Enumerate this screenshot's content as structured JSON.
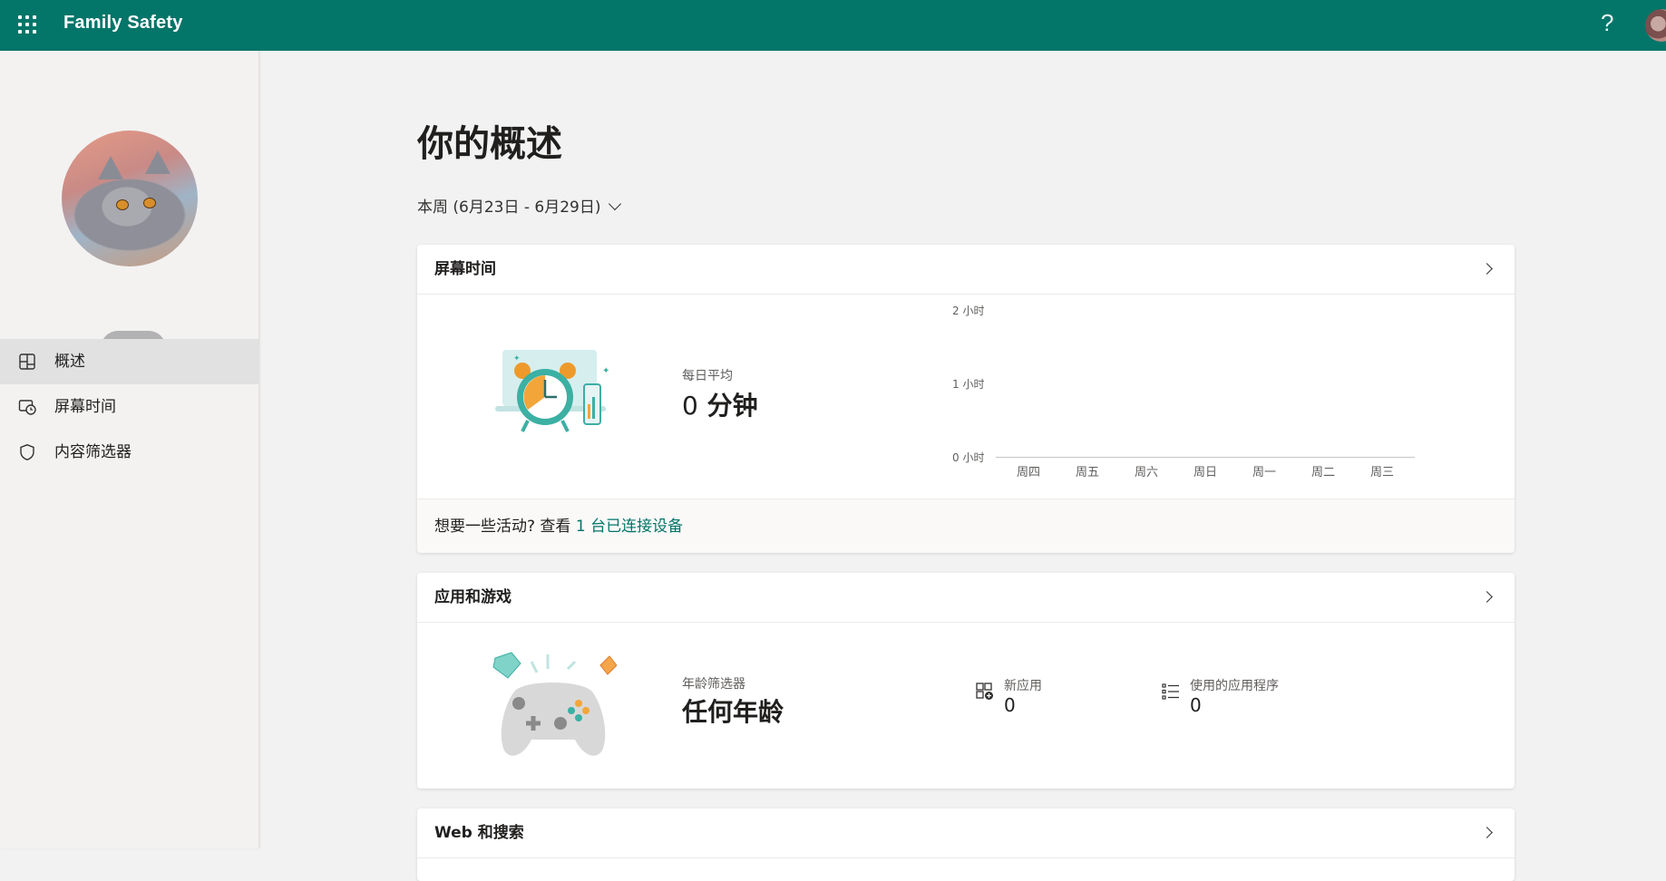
{
  "app": {
    "title": "Family Safety"
  },
  "header": {
    "help_label": "?"
  },
  "sidebar": {
    "items": [
      {
        "label": "概述",
        "icon": "overview-icon",
        "active": true
      },
      {
        "label": "屏幕时间",
        "icon": "screen-time-icon",
        "active": false
      },
      {
        "label": "内容筛选器",
        "icon": "shield-icon",
        "active": false
      }
    ]
  },
  "main": {
    "title": "你的概述",
    "week_label": "本周 (6月23日 - 6月29日)",
    "screen_time": {
      "title": "屏幕时间",
      "daily_avg_caption": "每日平均",
      "daily_avg_value": "0",
      "daily_avg_unit": "分钟",
      "footer_prefix": "想要一些活动?  查看 ",
      "footer_link": "1 台已连接设备"
    },
    "apps_games": {
      "title": "应用和游戏",
      "age_filter_caption": "年龄筛选器",
      "age_filter_value": "任何年龄",
      "new_apps_caption": "新应用",
      "new_apps_value": "0",
      "used_apps_caption": "使用的应用程序",
      "used_apps_value": "0"
    },
    "web_search": {
      "title": "Web 和搜索"
    }
  },
  "chart_data": {
    "type": "bar",
    "categories": [
      "周四",
      "周五",
      "周六",
      "周日",
      "周一",
      "周二",
      "周三"
    ],
    "values": [
      0,
      0,
      0,
      0,
      0,
      0,
      0
    ],
    "y_ticks": [
      "0 小时",
      "1 小时",
      "2 小时"
    ],
    "ylim": [
      0,
      2
    ],
    "grid": false
  },
  "colors": {
    "brand": "#037569",
    "link": "#037569"
  }
}
